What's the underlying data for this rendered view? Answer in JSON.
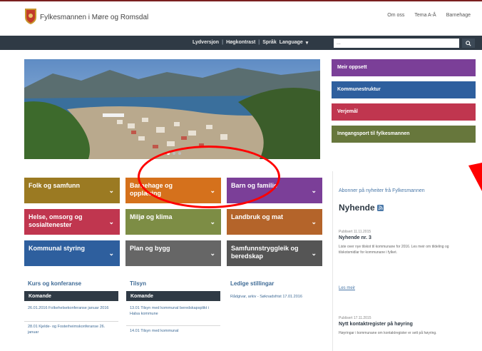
{
  "header": {
    "site_title": "Fylkesmannen i Møre og Romsdal",
    "links": [
      "Om oss",
      "Tema A-Å",
      "Barnehage"
    ]
  },
  "nav": {
    "items": [
      "Lydversjon",
      "Høgkontrast",
      "Språk",
      "Language"
    ],
    "search_value": "..."
  },
  "side_buttons": [
    {
      "label": "Meir oppsett",
      "color": "#7b3f98"
    },
    {
      "label": "Kommunestruktur",
      "color": "#2e5f9e"
    },
    {
      "label": "Verjemål",
      "color": "#c0364f"
    },
    {
      "label": "Inngangsport til fylkesmannen",
      "color": "#67773c"
    }
  ],
  "tiles": [
    {
      "label": "Folk og samfunn",
      "color": "#9b7a22"
    },
    {
      "label": "Barnehage og opplæring",
      "color": "#d5711c"
    },
    {
      "label": "Barn og familie",
      "color": "#7b3f98"
    },
    {
      "label": "Helse, omsorg og sosialtenester",
      "color": "#c0364f"
    },
    {
      "label": "Miljø og klima",
      "color": "#7d8d45"
    },
    {
      "label": "Landbruk og mat",
      "color": "#b4642a"
    },
    {
      "label": "Kommunal styring",
      "color": "#2e5f9e"
    },
    {
      "label": "Plan og bygg",
      "color": "#666666"
    },
    {
      "label": "Samfunnstryggleik og beredskap",
      "color": "#555555"
    }
  ],
  "news": {
    "subscribe": "Abonner på nyheiter frå Fylkesmannen",
    "heading": "Nyhende",
    "items": [
      {
        "date": "Publisert 11.11.2015",
        "title": "Nyhende nr. 3",
        "body": "Liste over nye tilskot til kommunane for 2016. Les meir om tildeling og tilskotsmidlar for kommunane i fylket."
      },
      {
        "date": "Publisert 17.11.2015",
        "title": "Nytt kontaktregister på høyring",
        "body": "Høyringar i kommunane om kontaktregister er sett på høyring."
      }
    ],
    "more": "Les meir"
  },
  "columns": [
    {
      "title": "Kurs og konferanse",
      "bar": "Komande",
      "items": [
        "26.01.2016 Folkehelsekonferanse januar 2016",
        "28.01 Kjelde- og Fosterheimskonferanse 26. januar"
      ]
    },
    {
      "title": "Tilsyn",
      "bar": "Komande",
      "items": [
        "13.01 Tilsyn med kommunal beredskapsplikt i Halsa kommune",
        "14.01 Tilsyn med kommunal"
      ]
    },
    {
      "title": "Ledige stillingar",
      "bar": "",
      "items": [
        "Rådgivar, arkiv - Søknadsfrist 17.01.2016"
      ]
    }
  ],
  "colors": {
    "nav_bg": "#2f3a45",
    "accent": "#3f6b96",
    "annotation": "#ff0000"
  }
}
